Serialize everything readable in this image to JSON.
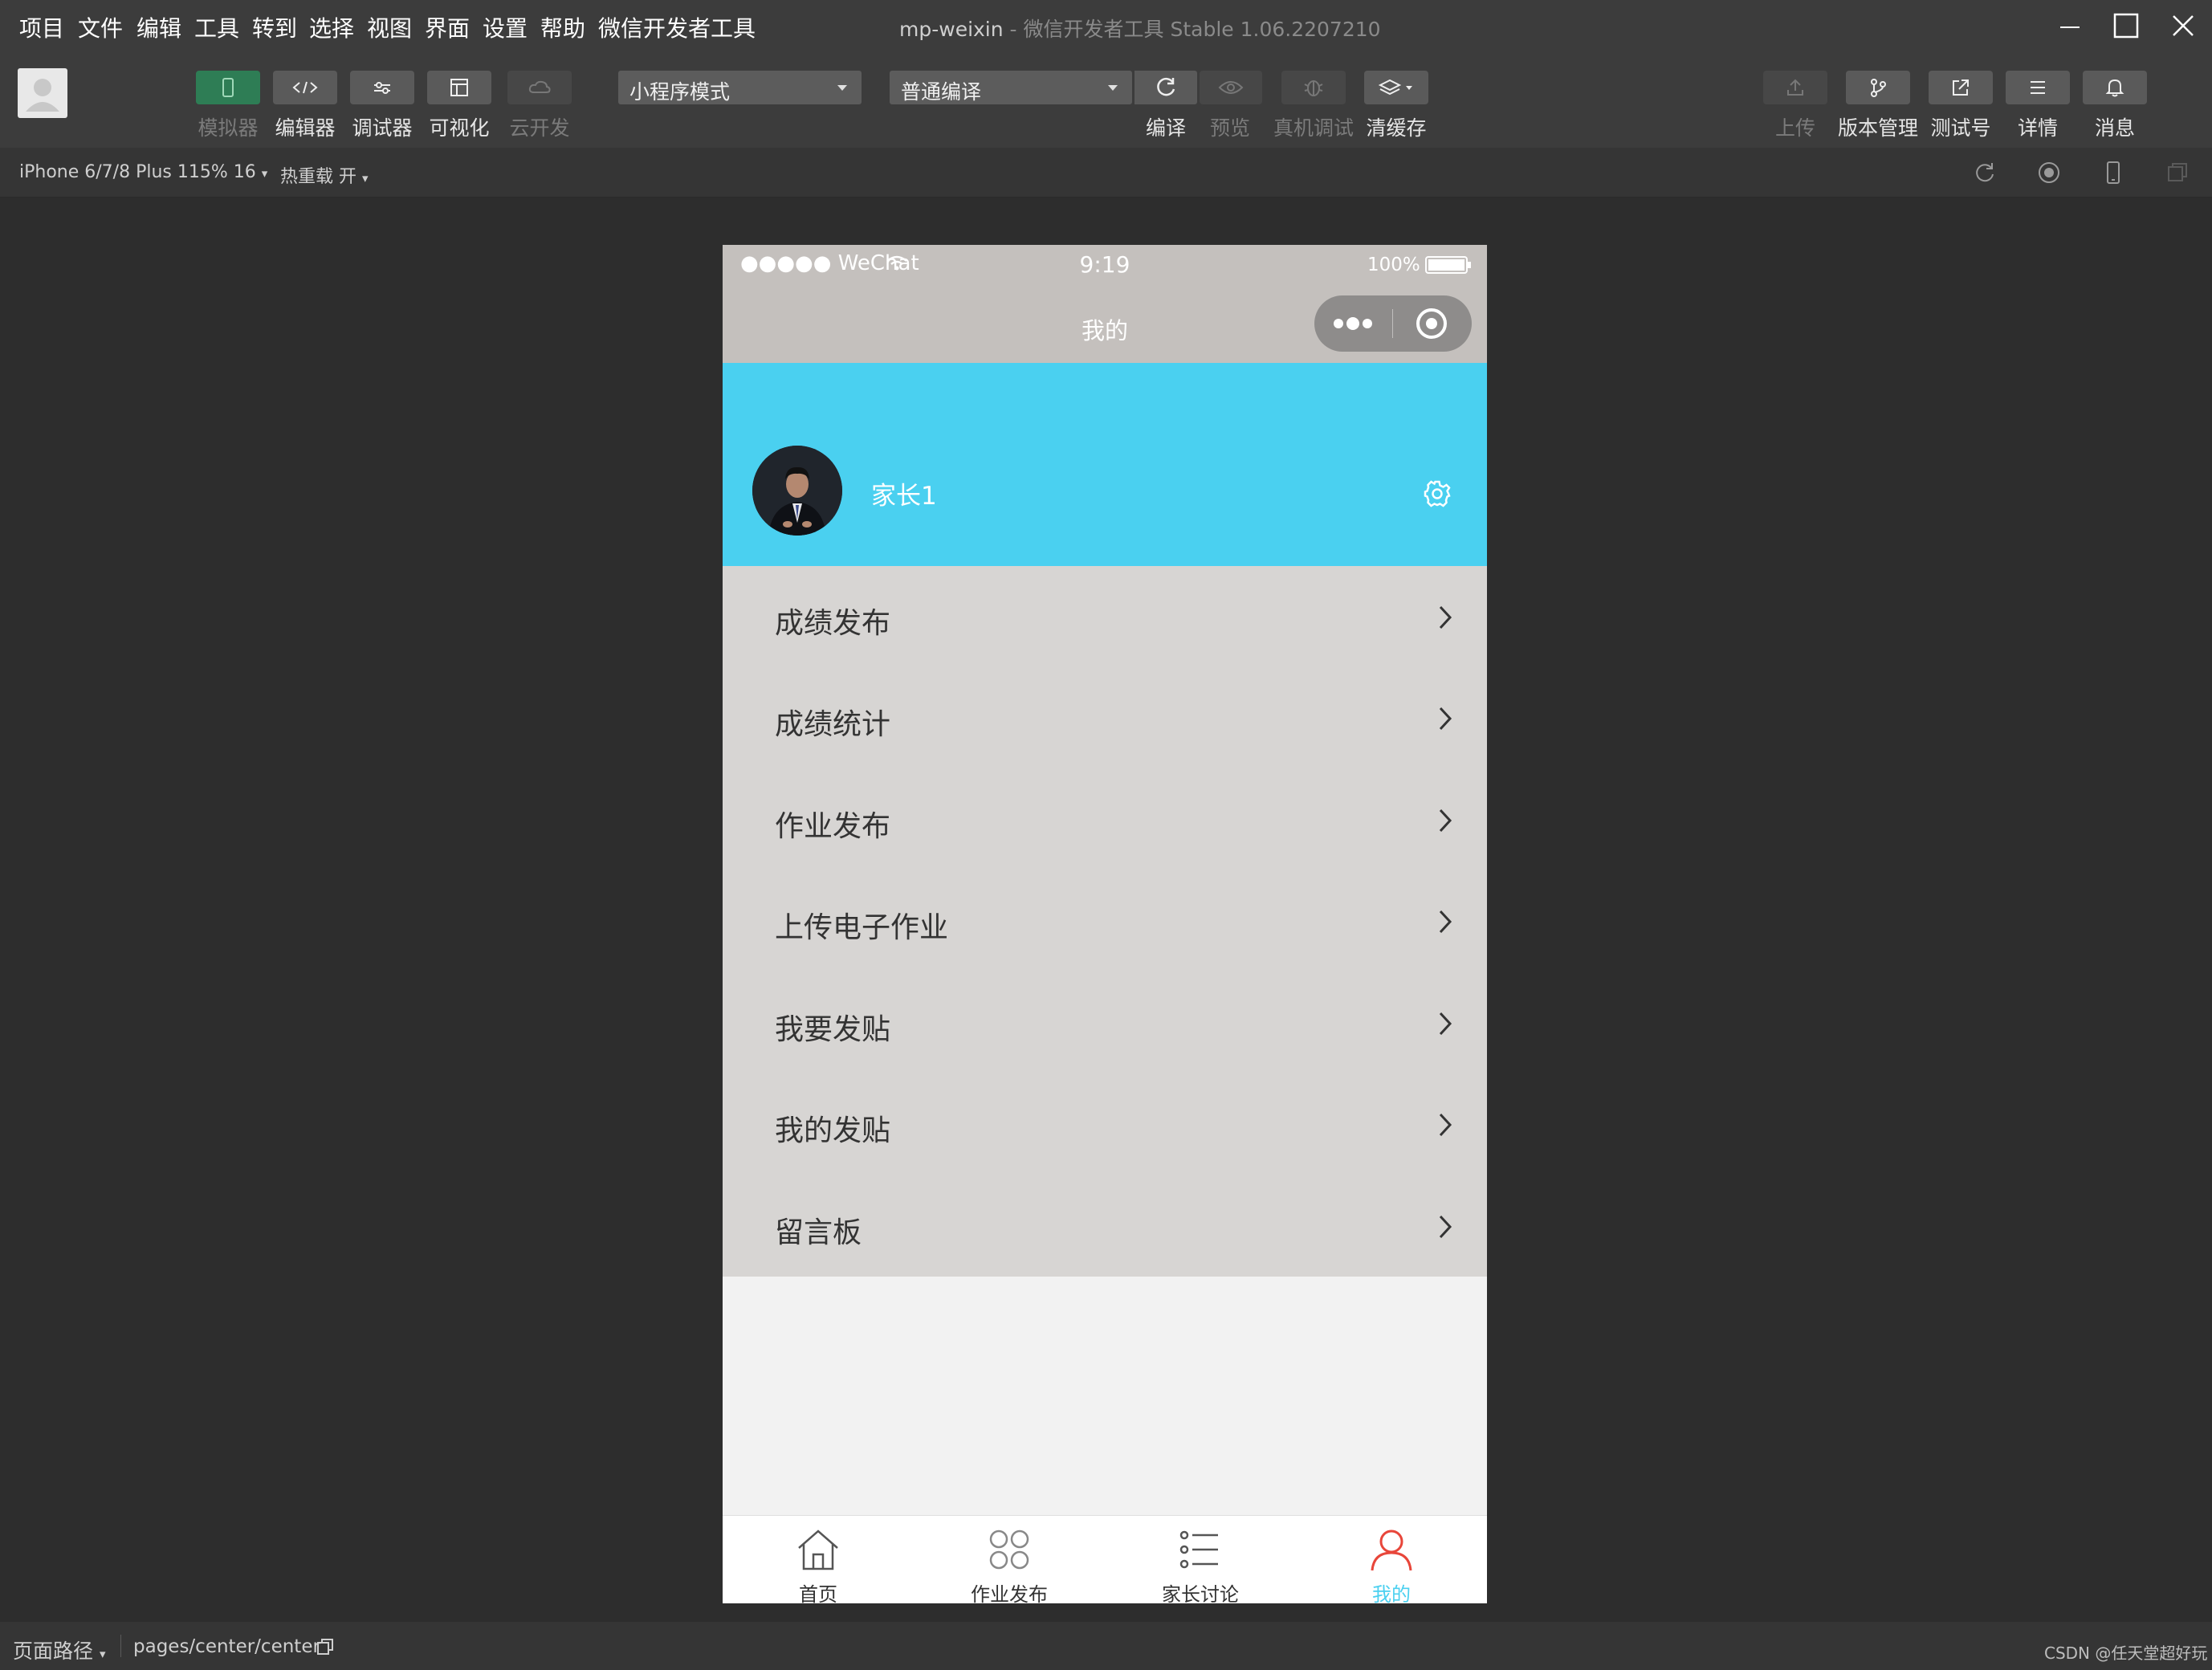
{
  "menu": [
    "项目",
    "文件",
    "编辑",
    "工具",
    "转到",
    "选择",
    "视图",
    "界面",
    "设置",
    "帮助",
    "微信开发者工具"
  ],
  "window_title": {
    "project": "mp-weixin",
    "app": " - 微信开发者工具 Stable 1.06.2207210"
  },
  "toolbar": {
    "simulator": "模拟器",
    "editor": "编辑器",
    "debugger": "调试器",
    "visual": "可视化",
    "cloud": "云开发",
    "mode_select": "小程序模式",
    "compile_select": "普通编译",
    "compile": "编译",
    "preview": "预览",
    "real_debug": "真机调试",
    "clear_cache": "清缓存",
    "upload": "上传",
    "version": "版本管理",
    "test_account": "测试号",
    "details": "详情",
    "messages": "消息"
  },
  "subbar": {
    "device": "iPhone 6/7/8 Plus 115% 16",
    "hot_reload": "热重载 开"
  },
  "phone": {
    "carrier": "●●●●● WeChat",
    "time": "9:19",
    "battery": "100%",
    "page_title": "我的",
    "username": "家长1",
    "menu_items": [
      "成绩发布",
      "成绩统计",
      "作业发布",
      "上传电子作业",
      "我要发贴",
      "我的发贴",
      "留言板"
    ],
    "tabs": [
      "首页",
      "作业发布",
      "家长讨论",
      "我的"
    ],
    "active_tab_color": "#4ad0f0",
    "profile_bg": "#4ad0f0"
  },
  "bottombar": {
    "path_label": "页面路径",
    "path": "pages/center/center",
    "watermark": "CSDN @任天堂超好玩"
  }
}
